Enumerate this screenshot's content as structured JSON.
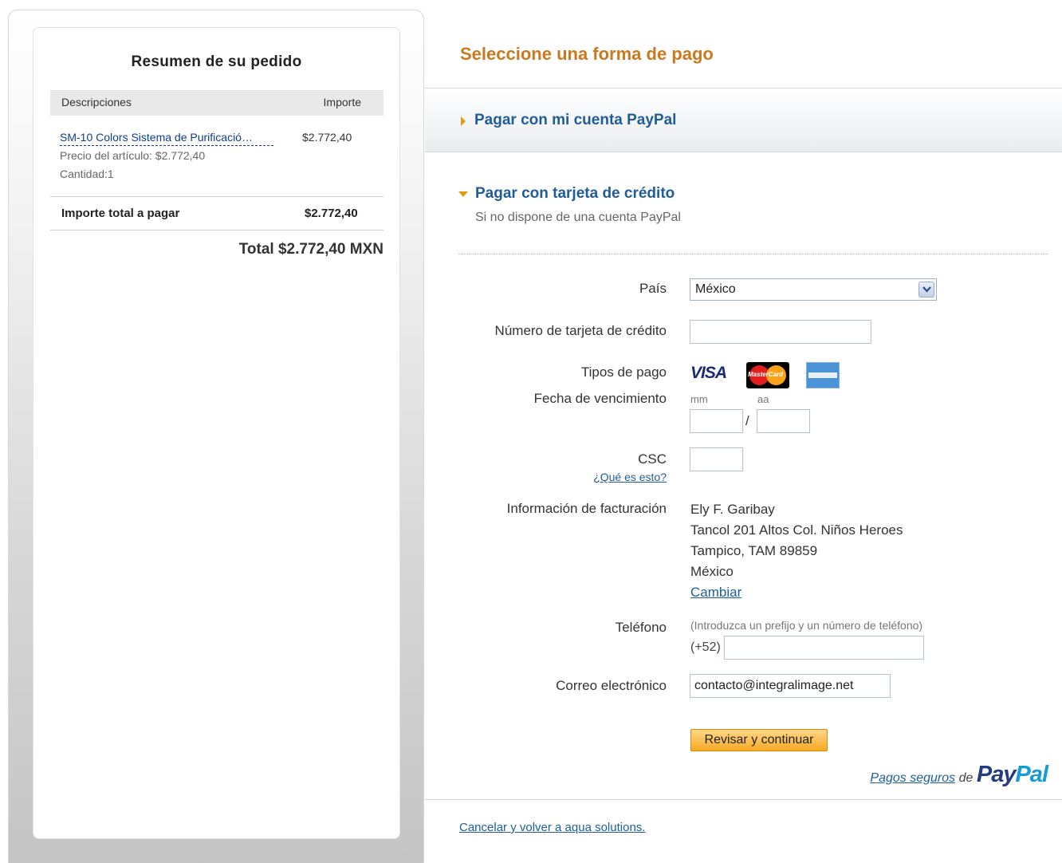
{
  "summary": {
    "title": "Resumen de su pedido",
    "col_description": "Descripciones",
    "col_amount": "Importe",
    "item": {
      "name": "SM-10 Colors Sistema de Purificació…",
      "amount": "$2.772,40",
      "price": "Precio del artículo: $2.772,40",
      "quantity": "Cantidad:1"
    },
    "total_label": "Importe total a pagar",
    "total_amount": "$2.772,40",
    "grand_total": "Total $2.772,40 MXN"
  },
  "payment": {
    "title": "Seleccione una forma de pago",
    "paypal_account_link": "Pagar con mi cuenta PayPal",
    "credit_card_heading": "Pagar con tarjeta de crédito",
    "credit_card_subtitle": "Si no dispone de una cuenta PayPal"
  },
  "form": {
    "country_label": "País",
    "country_value": "México",
    "card_number_label": "Número de tarjeta de crédito",
    "card_number_value": "",
    "payment_types_label": "Tipos de pago",
    "card_types": [
      "VISA",
      "MasterCard",
      "American Express"
    ],
    "expiry_label": "Fecha de vencimiento",
    "expiry_month_label": "mm",
    "expiry_year_label": "aa",
    "expiry_separator": "/",
    "csc_label": "CSC",
    "csc_help_link": "¿Qué es esto?",
    "billing_label": "Información de facturación",
    "billing": {
      "name": "Ely F. Garibay",
      "street": "Tancol 201 Altos Col. Niños Heroes",
      "city": "Tampico, TAM 89859",
      "country": "México",
      "change_link": "Cambiar"
    },
    "phone_label": "Teléfono",
    "phone_hint": "(Introduzca un prefijo y un número de teléfono)",
    "phone_prefix": "(+52)",
    "phone_value": "",
    "email_label": "Correo electrónico",
    "email_value": "contacto@integralimage.net",
    "continue_button": "Revisar y continuar"
  },
  "footer": {
    "secure_link": "Pagos seguros",
    "secure_de": "de",
    "brand_pay": "Pay",
    "brand_pal": "Pal",
    "cancel_link": "Cancelar y volver a aqua solutions."
  },
  "colors": {
    "accent_orange": "#c97a1e",
    "link_blue": "#1e5d9a",
    "button_orange": "#f7a823"
  }
}
